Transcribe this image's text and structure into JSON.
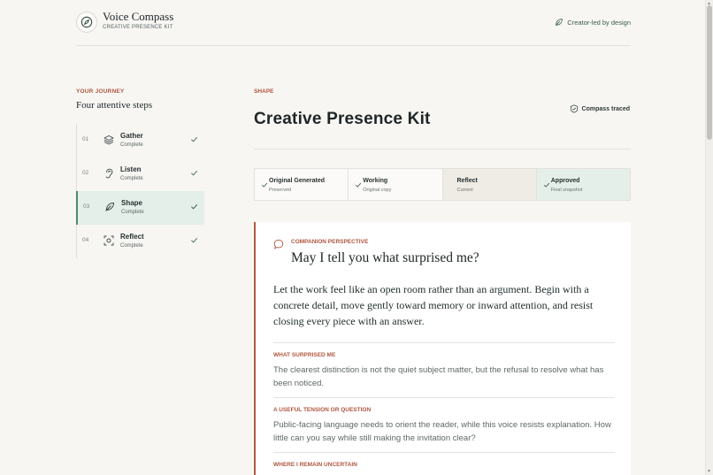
{
  "header": {
    "title": "Voice Compass",
    "subtitle": "CREATIVE PRESENCE KIT",
    "tagline": "Creator-led by design"
  },
  "sidebar": {
    "label": "YOUR JOURNEY",
    "title": "Four attentive steps",
    "steps": [
      {
        "num": "01",
        "name": "Gather",
        "status": "Complete",
        "icon": "layers-icon"
      },
      {
        "num": "02",
        "name": "Listen",
        "status": "Complete",
        "icon": "ear-icon"
      },
      {
        "num": "03",
        "name": "Shape",
        "status": "Complete",
        "icon": "feather-icon"
      },
      {
        "num": "04",
        "name": "Reflect",
        "status": "Complete",
        "icon": "focus-icon"
      }
    ]
  },
  "main": {
    "section_label": "SHAPE",
    "title": "Creative Presence Kit",
    "traced": "Compass traced",
    "tiles": [
      {
        "title": "Original Generated",
        "sub": "Preserved"
      },
      {
        "title": "Working",
        "sub": "Original copy"
      },
      {
        "title": "Reflect",
        "sub": "Current"
      },
      {
        "title": "Approved",
        "sub": "Final snapshot"
      }
    ],
    "card": {
      "label": "COMPANION PERSPECTIVE",
      "question": "May I tell you what surprised me?",
      "body": "Let the work feel like an open room rather than an argument. Begin with a concrete detail, move gently toward memory or inward attention, and resist closing every piece with an answer.",
      "blocks": [
        {
          "label": "WHAT SURPRISED ME",
          "text": "The clearest distinction is not the quiet subject matter, but the refusal to resolve what has been noticed."
        },
        {
          "label": "A USEFUL TENSION OR QUESTION",
          "text": "Public-facing language needs to orient the reader, while this voice resists explanation. How little can you say while still making the invitation clear?"
        },
        {
          "label": "WHERE I REMAIN UNCERTAIN",
          "text": ""
        }
      ]
    }
  },
  "colors": {
    "accent": "#b0573f",
    "green": "#4f8a6e",
    "active_bg": "#e5efea"
  }
}
